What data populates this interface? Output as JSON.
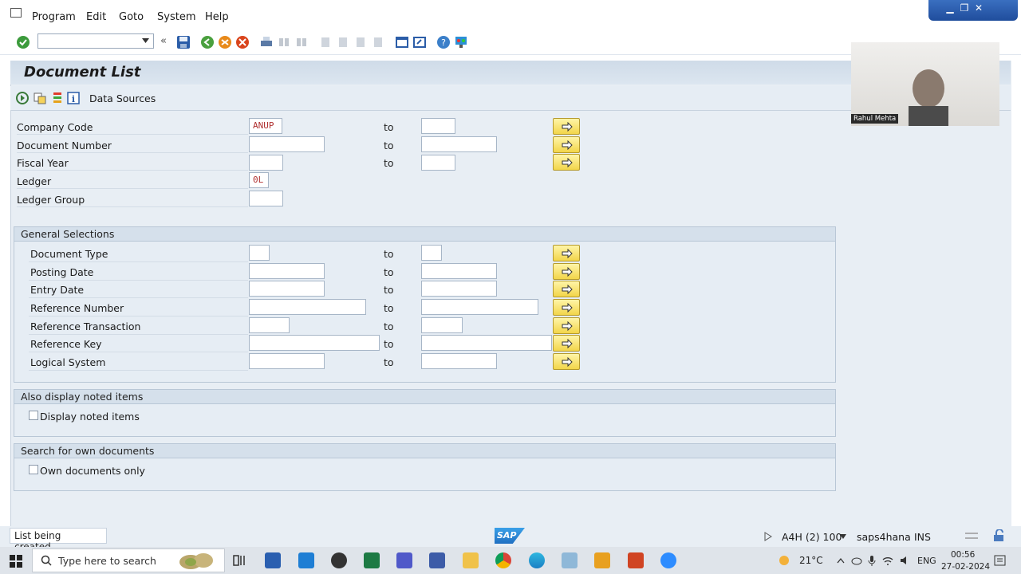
{
  "menu": [
    "Program",
    "Edit",
    "Goto",
    "System",
    "Help"
  ],
  "window_controls": {
    "minimize": "▁",
    "restore": "❐",
    "close": "✕"
  },
  "title": "Document List",
  "app_toolbar": {
    "data_sources_label": "Data Sources"
  },
  "fields": [
    {
      "label": "Company Code",
      "from": "ANUP",
      "to": "",
      "has_to": true
    },
    {
      "label": "Document Number",
      "from": "",
      "to": "",
      "has_to": true
    },
    {
      "label": "Fiscal Year",
      "from": "",
      "to": "",
      "has_to": true
    },
    {
      "label": "Ledger",
      "from": "0L",
      "has_to": false
    },
    {
      "label": "Ledger Group",
      "from": "",
      "has_to": false
    }
  ],
  "to_label": "to",
  "general_selections": {
    "header": "General Selections",
    "rows": [
      {
        "label": "Document Type"
      },
      {
        "label": "Posting Date"
      },
      {
        "label": "Entry Date"
      },
      {
        "label": "Reference Number"
      },
      {
        "label": "Reference Transaction"
      },
      {
        "label": "Reference Key"
      },
      {
        "label": "Logical System"
      }
    ]
  },
  "noted_items": {
    "header": "Also display noted items",
    "checkbox": "Display noted items",
    "checked": false
  },
  "own_docs": {
    "header": "Search for own documents",
    "checkbox": "Own documents only",
    "checked": false
  },
  "status": {
    "message": "List being created...",
    "logo": "SAP",
    "system": "A4H (2) 100",
    "server": "saps4hana",
    "mode": "INS"
  },
  "webcam": {
    "name": "Rahul Mehta"
  },
  "taskbar": {
    "search_placeholder": "Type here to search",
    "temperature": "21°C",
    "language": "ENG",
    "time": "00:56",
    "date": "27-02-2024"
  },
  "colors": {
    "sap_blue": "#1f6fc1",
    "button_yellow": "#f2d54a",
    "panel": "#e6edf4"
  }
}
